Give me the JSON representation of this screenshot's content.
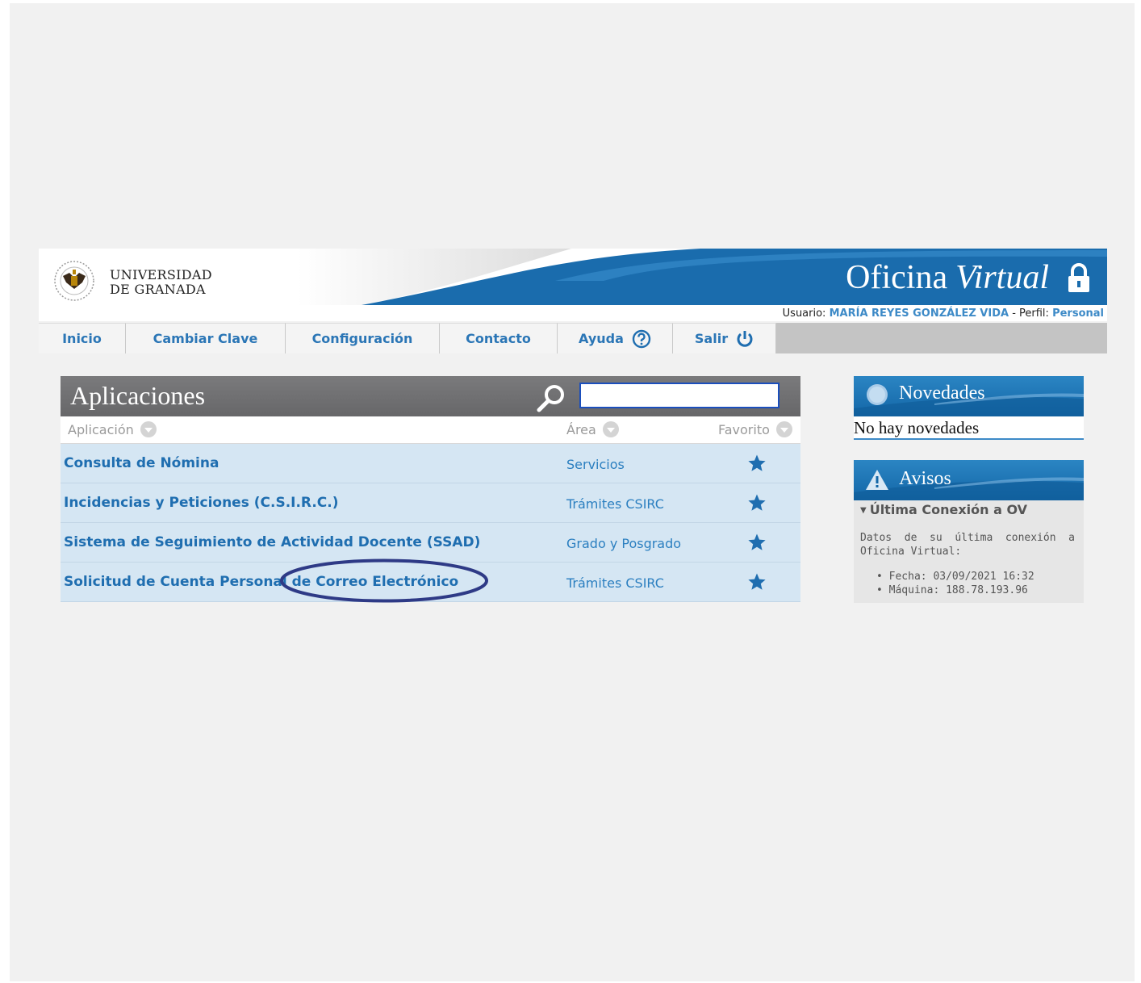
{
  "header": {
    "university_line1": "UNIVERSIDAD",
    "university_line2": "DE GRANADA",
    "title_part1": "Oficina",
    "title_part2": "Virtual",
    "user_label": "Usuario:",
    "user_name": "MARÍA REYES GONZÁLEZ VIDA",
    "profile_separator": "- Perfil:",
    "profile_value": "Personal"
  },
  "nav": {
    "items": [
      {
        "label": "Inicio"
      },
      {
        "label": "Cambiar Clave"
      },
      {
        "label": "Configuración"
      },
      {
        "label": "Contacto"
      },
      {
        "label": "Ayuda",
        "icon": "help-icon"
      },
      {
        "label": "Salir",
        "icon": "power-icon"
      }
    ]
  },
  "apps": {
    "title": "Aplicaciones",
    "search_value": "",
    "columns": {
      "app": "Aplicación",
      "area": "Área",
      "fav": "Favorito"
    },
    "rows": [
      {
        "name": "Consulta de Nómina",
        "area": "Servicios"
      },
      {
        "name": "Incidencias y Peticiones (C.S.I.R.C.)",
        "area": "Trámites CSIRC"
      },
      {
        "name": "Sistema de Seguimiento de Actividad Docente (SSAD)",
        "area": "Grado y Posgrado"
      },
      {
        "name": "Solicitud de Cuenta Personal de Correo Electrónico",
        "area": "Trámites CSIRC"
      }
    ]
  },
  "novedades": {
    "title": "Novedades",
    "message": "No hay novedades"
  },
  "avisos": {
    "title": "Avisos",
    "section": "Última Conexión a OV",
    "description": "Datos de su última conexión a Oficina Virtual:",
    "fecha": "Fecha: 03/09/2021 16:32",
    "maquina": "Máquina: 188.78.193.96"
  },
  "colors": {
    "brand_blue": "#1366a7",
    "link_blue": "#1f6eb0",
    "row_bg": "#d5e6f3",
    "annotation": "#2e3a86"
  }
}
